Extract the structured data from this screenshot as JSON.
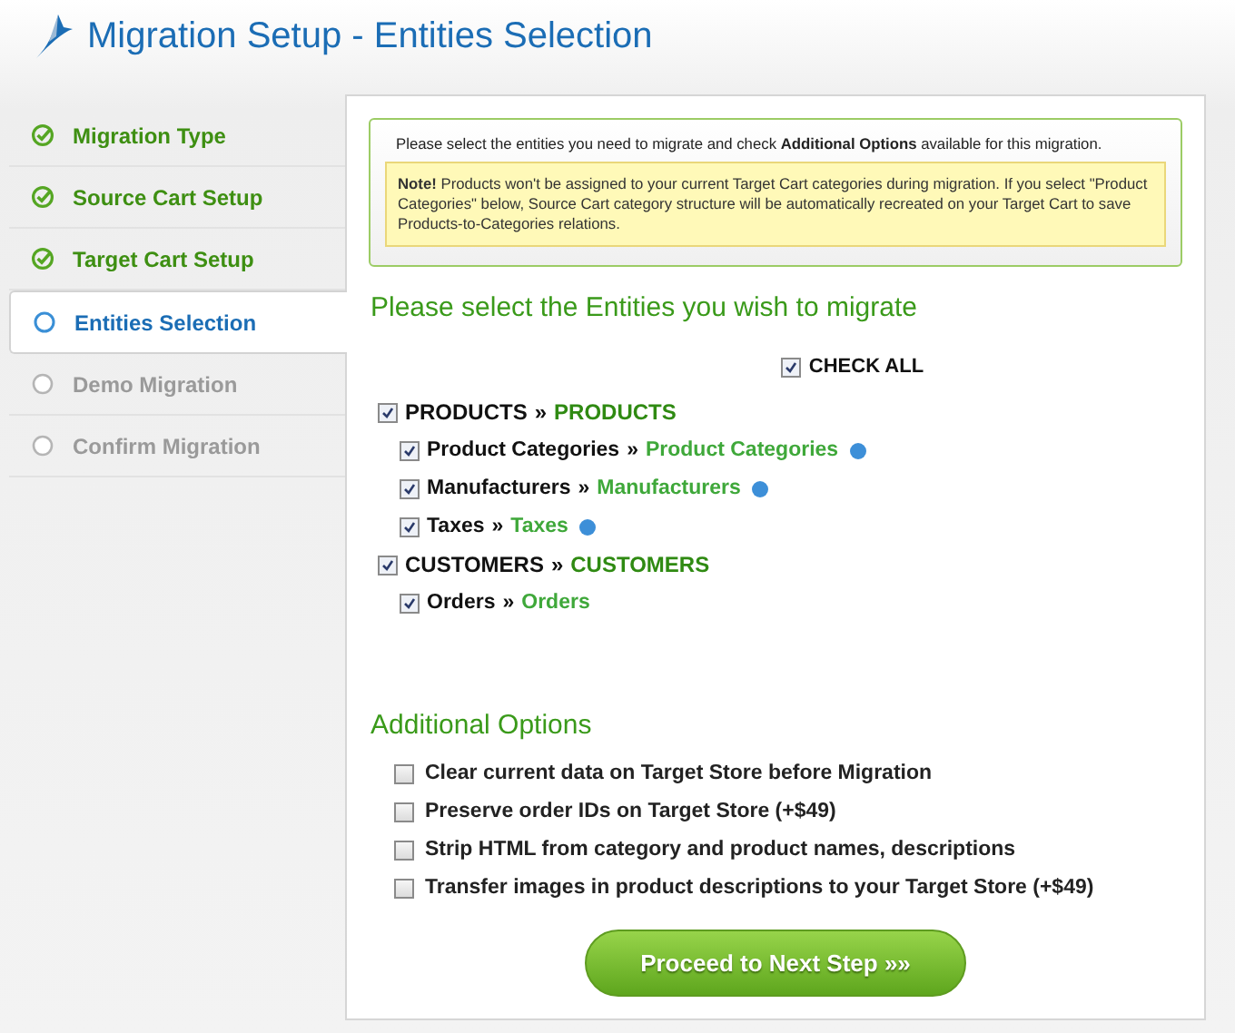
{
  "title": "Migration Setup - Entities Selection",
  "steps": [
    {
      "label": "Migration Type",
      "kind": "done",
      "selected": false
    },
    {
      "label": "Source Cart Setup",
      "kind": "done",
      "selected": false
    },
    {
      "label": "Target Cart Setup",
      "kind": "done",
      "selected": false
    },
    {
      "label": "Entities Selection",
      "kind": "current",
      "selected": true
    },
    {
      "label": "Demo Migration",
      "kind": "pending",
      "selected": false
    },
    {
      "label": "Confirm Migration",
      "kind": "pending",
      "selected": false
    }
  ],
  "info": {
    "text": "Please select the entities you need to migrate and check **Additional Options** available for this migration.",
    "note": "**Note!** Products won't be assigned to your current Target Cart categories during migration. If you select \"Product Categories\" below, Source Cart category structure will be automatically recreated on your Target Cart to save Products-to-Categories relations."
  },
  "entities_heading": "Please select the Entities you wish to migrate",
  "check_all": {
    "label": "CHECK ALL",
    "checked": true
  },
  "entities": [
    {
      "source": "PRODUCTS",
      "separator": "»",
      "target": "PRODUCTS",
      "checked": true,
      "help": false,
      "children": [
        {
          "source": "Product Categories",
          "separator": "»",
          "target": "Product Categories",
          "checked": true,
          "help": true
        },
        {
          "source": "Manufacturers",
          "separator": "»",
          "target": "Manufacturers",
          "checked": true,
          "help": true
        },
        {
          "source": "Taxes",
          "separator": "»",
          "target": "Taxes",
          "checked": true,
          "help": true
        }
      ]
    },
    {
      "source": "CUSTOMERS",
      "separator": "»",
      "target": "CUSTOMERS",
      "checked": true,
      "help": false,
      "children": [
        {
          "source": "Orders",
          "separator": "»",
          "target": "Orders",
          "checked": true,
          "help": false
        }
      ]
    }
  ],
  "options_heading": "Additional Options",
  "options": [
    {
      "label": "Clear current data on Target Store before Migration",
      "checked": false
    },
    {
      "label": "Preserve order IDs on Target Store (+$49)",
      "checked": false
    },
    {
      "label": "Strip HTML from category and product names, descriptions",
      "checked": false
    },
    {
      "label": "Transfer images in product descriptions to your Target Store (+$49)",
      "checked": false
    }
  ],
  "button": "Proceed to Next Step »»"
}
